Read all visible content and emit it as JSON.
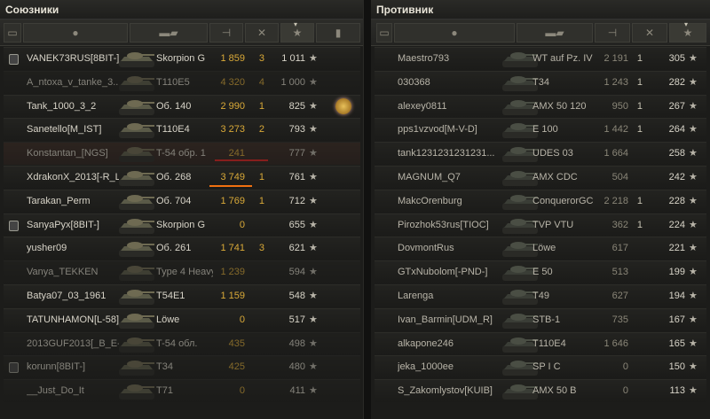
{
  "panels": {
    "allies": {
      "title": "Союзники"
    },
    "enemies": {
      "title": "Противник"
    }
  },
  "header_icons": [
    "platoon-icon",
    "player-icon",
    "tank-icon",
    "damage-icon",
    "kills-icon",
    "xp-icon",
    "medal-icon"
  ],
  "colors": {
    "gold": "#d9a938",
    "red_underline": "#e02020",
    "orange_underline": "#f07010"
  },
  "allies": [
    {
      "platoon": true,
      "name": "VANEK73RUS[8BIT-]",
      "tank": "Skorpion G",
      "damage": "1 859",
      "kills": "3",
      "xp": "1 011",
      "dead": false
    },
    {
      "platoon": false,
      "name": "A_ntoxa_v_tanke_3...",
      "tank": "T110E5",
      "damage": "4 320",
      "kills": "4",
      "xp": "1 000",
      "dead": true
    },
    {
      "platoon": false,
      "name": "Tank_1000_3_2",
      "tank": "Об. 140",
      "damage": "2 990",
      "kills": "1",
      "xp": "825",
      "dead": false,
      "medal": true
    },
    {
      "platoon": false,
      "name": "Sanetello[M_IST]",
      "tank": "T110E4",
      "damage": "3 273",
      "kills": "2",
      "xp": "793",
      "dead": false
    },
    {
      "platoon": false,
      "name": "Konstantan_[NGS]",
      "tank": "T-54 обр. 1",
      "damage": "241",
      "kills": "",
      "xp": "777",
      "dead": true,
      "highlight": true
    },
    {
      "platoon": false,
      "name": "XdrakonX_2013[-R_L]",
      "tank": "Об. 268",
      "damage": "3 749",
      "kills": "1",
      "xp": "761",
      "dead": false
    },
    {
      "platoon": false,
      "name": "Tarakan_Perm",
      "tank": "Об. 704",
      "damage": "1 769",
      "kills": "1",
      "xp": "712",
      "dead": false
    },
    {
      "platoon": true,
      "name": "SanyaPyx[8BIT-]",
      "tank": "Skorpion G",
      "damage": "0",
      "kills": "",
      "xp": "655",
      "dead": false
    },
    {
      "platoon": false,
      "name": "yusher09",
      "tank": "Об. 261",
      "damage": "1 741",
      "kills": "3",
      "xp": "621",
      "dead": false
    },
    {
      "platoon": false,
      "name": "Vanya_TEKKEN",
      "tank": "Type 4 Heavy",
      "damage": "1 239",
      "kills": "",
      "xp": "594",
      "dead": true
    },
    {
      "platoon": false,
      "name": "Batya07_03_1961",
      "tank": "T54E1",
      "damage": "1 159",
      "kills": "",
      "xp": "548",
      "dead": false
    },
    {
      "platoon": false,
      "name": "TATUNHAMON[L-58]",
      "tank": "Löwe",
      "damage": "0",
      "kills": "",
      "xp": "517",
      "dead": false
    },
    {
      "platoon": false,
      "name": "2013GUF2013[_B_E-]",
      "tank": "T-54 обл.",
      "damage": "435",
      "kills": "",
      "xp": "498",
      "dead": true
    },
    {
      "platoon": true,
      "name": "korunn[8BIT-]",
      "tank": "T34",
      "damage": "425",
      "kills": "",
      "xp": "480",
      "dead": true
    },
    {
      "platoon": false,
      "name": "__Just_Do_It",
      "tank": "T71",
      "damage": "0",
      "kills": "",
      "xp": "411",
      "dead": true
    }
  ],
  "enemies": [
    {
      "name": "Maestro793",
      "tank": "WT auf Pz. IV",
      "damage": "2 191",
      "kills": "1",
      "xp": "305"
    },
    {
      "name": "030368",
      "tank": "T34",
      "damage": "1 243",
      "kills": "1",
      "xp": "282"
    },
    {
      "name": "alexey0811",
      "tank": "AMX 50 120",
      "damage": "950",
      "kills": "1",
      "xp": "267"
    },
    {
      "name": "pps1vzvod[M-V-D]",
      "tank": "E 100",
      "damage": "1 442",
      "kills": "1",
      "xp": "264"
    },
    {
      "name": "tank1231231231231...",
      "tank": "UDES 03",
      "damage": "1 664",
      "kills": "",
      "xp": "258"
    },
    {
      "name": "MAGNUM_Q7",
      "tank": "AMX CDC",
      "damage": "504",
      "kills": "",
      "xp": "242"
    },
    {
      "name": "MakcOrenburg",
      "tank": "ConquerorGC",
      "damage": "2 218",
      "kills": "1",
      "xp": "228"
    },
    {
      "name": "Pirozhok53rus[TIOC]",
      "tank": "TVP VTU",
      "damage": "362",
      "kills": "1",
      "xp": "224"
    },
    {
      "name": "DovmontRus",
      "tank": "Löwe",
      "damage": "617",
      "kills": "",
      "xp": "221"
    },
    {
      "name": "GTxNubolom[-PND-]",
      "tank": "E 50",
      "damage": "513",
      "kills": "",
      "xp": "199"
    },
    {
      "name": "Larenga",
      "tank": "T49",
      "damage": "627",
      "kills": "",
      "xp": "194"
    },
    {
      "name": "Ivan_Barmin[UDM_R]",
      "tank": "STB-1",
      "damage": "735",
      "kills": "",
      "xp": "167"
    },
    {
      "name": "alkapone246",
      "tank": "T110E4",
      "damage": "1 646",
      "kills": "",
      "xp": "165"
    },
    {
      "name": "jeka_1000ee",
      "tank": "SP I C",
      "damage": "0",
      "kills": "",
      "xp": "150"
    },
    {
      "name": "S_Zakomlystov[KUIB]",
      "tank": "AMX 50 B",
      "damage": "0",
      "kills": "",
      "xp": "113"
    }
  ]
}
